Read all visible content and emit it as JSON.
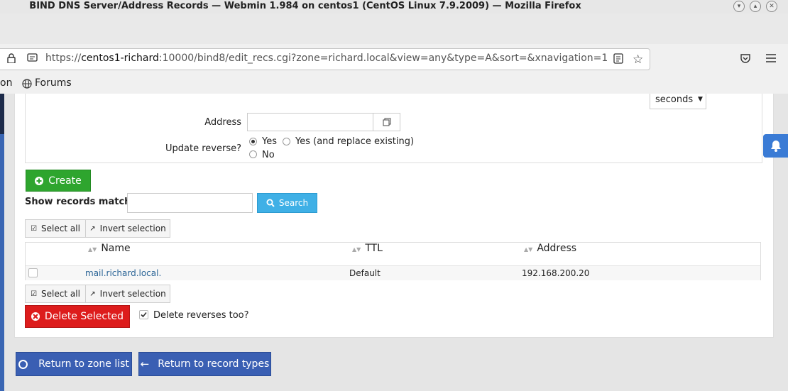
{
  "window": {
    "title": "BIND DNS Server/Address Records — Webmin 1.984 on centos1 (CentOS Linux 7.9.2009) — Mozilla Firefox"
  },
  "browser": {
    "url_prefix": "https://",
    "url_host": "centos1-richard",
    "url_rest": ":10000/bind8/edit_recs.cgi?zone=richard.local&view=any&type=A&sort=&xnavigation=1",
    "bookmarks": {
      "partial": "on",
      "forums": "Forums"
    }
  },
  "form": {
    "ttl_unit": "seconds",
    "address_label": "Address",
    "address_value": "",
    "update_reverse_label": "Update reverse?",
    "options": [
      "Yes",
      "Yes (and replace existing)",
      "No"
    ],
    "create_label": "Create"
  },
  "search": {
    "label": "Show records matching:",
    "value": "",
    "button": "Search"
  },
  "selection": {
    "select_all": "Select all",
    "invert": "Invert selection"
  },
  "table": {
    "headers": [
      "Name",
      "TTL",
      "Address"
    ],
    "rows": [
      {
        "name": "mail.richard.local.",
        "ttl": "Default",
        "address": "192.168.200.20"
      }
    ]
  },
  "delete": {
    "button": "Delete Selected",
    "reverses_label": "Delete reverses too?"
  },
  "footer": {
    "return_zone": "Return to zone list",
    "return_types": "Return to record types"
  },
  "colors": {
    "green": "#2ea52e",
    "red": "#dd1c1c",
    "blue": "#3a5fb3",
    "cyan": "#3fb0e6",
    "link": "#2a6496"
  }
}
